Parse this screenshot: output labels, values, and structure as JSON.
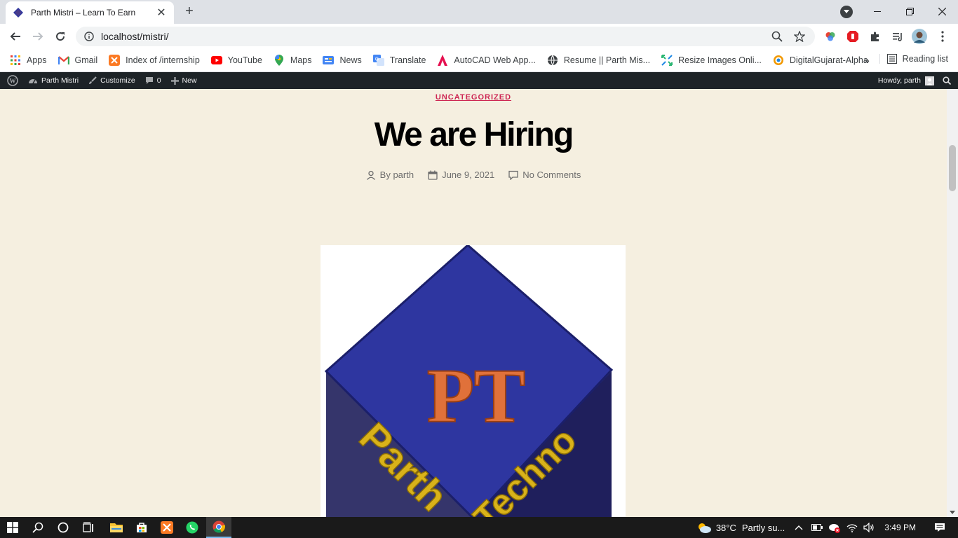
{
  "browser": {
    "tab_title": "Parth Mistri – Learn To Earn",
    "url": "localhost/mistri/",
    "bookmarks": [
      {
        "label": "Apps",
        "icon": "apps-grid-icon",
        "color": "#4285f4"
      },
      {
        "label": "Gmail",
        "icon": "gmail-icon",
        "color": "#ea4335"
      },
      {
        "label": "Index of /internship",
        "icon": "xampp-icon",
        "color": "#fb7a24"
      },
      {
        "label": "YouTube",
        "icon": "youtube-icon",
        "color": "#ff0000"
      },
      {
        "label": "Maps",
        "icon": "maps-pin-icon",
        "color": "#34a853"
      },
      {
        "label": "News",
        "icon": "news-icon",
        "color": "#4285f4"
      },
      {
        "label": "Translate",
        "icon": "translate-icon",
        "color": "#4285f4"
      },
      {
        "label": "AutoCAD Web App...",
        "icon": "autocad-icon",
        "color": "#e51050"
      },
      {
        "label": "Resume || Parth Mis...",
        "icon": "globe-icon",
        "color": "#3c4043"
      },
      {
        "label": "Resize Images Onli...",
        "icon": "resize-icon",
        "color": "#2bb673"
      },
      {
        "label": "DigitalGujarat-Alpha",
        "icon": "digitalgujarat-icon",
        "color": "#f29900"
      }
    ],
    "reading_list": "Reading list"
  },
  "adminbar": {
    "site_name": "Parth Mistri",
    "customize": "Customize",
    "comments_count": "0",
    "new": "New",
    "howdy": "Howdy, parth"
  },
  "post": {
    "category": "UNCATEGORIZED",
    "title": "We are Hiring",
    "author": "By parth",
    "date": "June 9, 2021",
    "comments": "No Comments",
    "image_text": {
      "letters": "PT",
      "left_face": "Parth",
      "right_face": "Techno"
    }
  },
  "taskbar": {
    "temperature": "38°C",
    "weather": "Partly su...",
    "time": "3:49 PM"
  },
  "colors": {
    "accent": "#cd2653",
    "page_bg": "#f5efe0",
    "adminbar_bg": "#1d2327",
    "cube_top": "#2e36a0",
    "letters": "#e0713a",
    "face_text": "#d9b21a"
  }
}
